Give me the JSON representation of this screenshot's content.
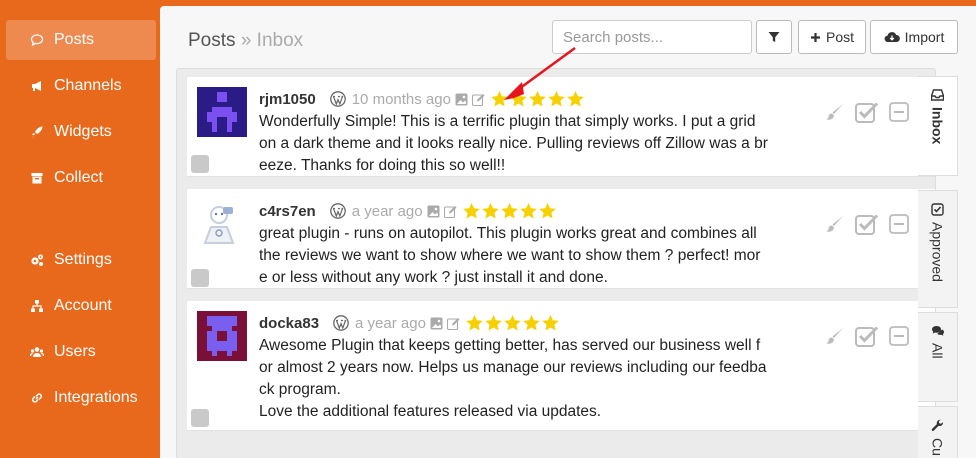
{
  "sidebar": {
    "items": [
      {
        "label": "Posts",
        "icon": "comment-icon",
        "active": true
      },
      {
        "label": "Channels",
        "icon": "bullhorn-icon"
      },
      {
        "label": "Widgets",
        "icon": "rocket-icon"
      },
      {
        "label": "Collect",
        "icon": "archive-icon"
      },
      {
        "label": "Settings",
        "icon": "gears-icon"
      },
      {
        "label": "Account",
        "icon": "sitemap-icon"
      },
      {
        "label": "Users",
        "icon": "users-icon"
      },
      {
        "label": "Integrations",
        "icon": "link-icon"
      }
    ]
  },
  "header": {
    "title": "Posts",
    "separator": "»",
    "subtitle": "Inbox",
    "search_placeholder": "Search posts...",
    "post_label": "Post",
    "import_label": "Import"
  },
  "posts": [
    {
      "author": "rjm1050",
      "time": "10 months ago",
      "rating": 5,
      "text": "Wonderfully Simple! This is a terrific plugin that simply works. I put a grid on a dark theme and it looks really nice. Pulling reviews off Zillow was a breeze. Thanks for doing this so well!!",
      "lines": [
        "Wonderfully Simple! This is a terrific plugin that simply works. I put a grid",
        "on a dark theme and it looks really nice. Pulling reviews off Zillow was a br",
        "eeze. Thanks for doing this so well!!"
      ]
    },
    {
      "author": "c4rs7en",
      "time": "a year ago",
      "rating": 5,
      "lines": [
        "great plugin - runs on autopilot. This plugin works great and combines all",
        "the reviews we want to show where we want to show them ? perfect! mor",
        "e or less without any work ? just install it and done."
      ]
    },
    {
      "author": "docka83",
      "time": "a year ago",
      "rating": 5,
      "lines": [
        "Awesome Plugin that keeps getting better, has served our business well f",
        "or almost 2 years now. Helps us manage our reviews including our feedba",
        "ck program.",
        "Love the additional features released via updates."
      ]
    }
  ],
  "tabs": [
    {
      "label": "Inbox",
      "icon": "inbox-icon",
      "active": true
    },
    {
      "label": "Approved",
      "icon": "check-square-icon"
    },
    {
      "label": "All",
      "icon": "comments-icon"
    },
    {
      "label": "Cu",
      "icon": "wrench-icon"
    }
  ],
  "colors": {
    "sidebar": "#e8691c",
    "active": "#ee8a50",
    "star": "#f7d000",
    "annotation": "#e8141c"
  }
}
